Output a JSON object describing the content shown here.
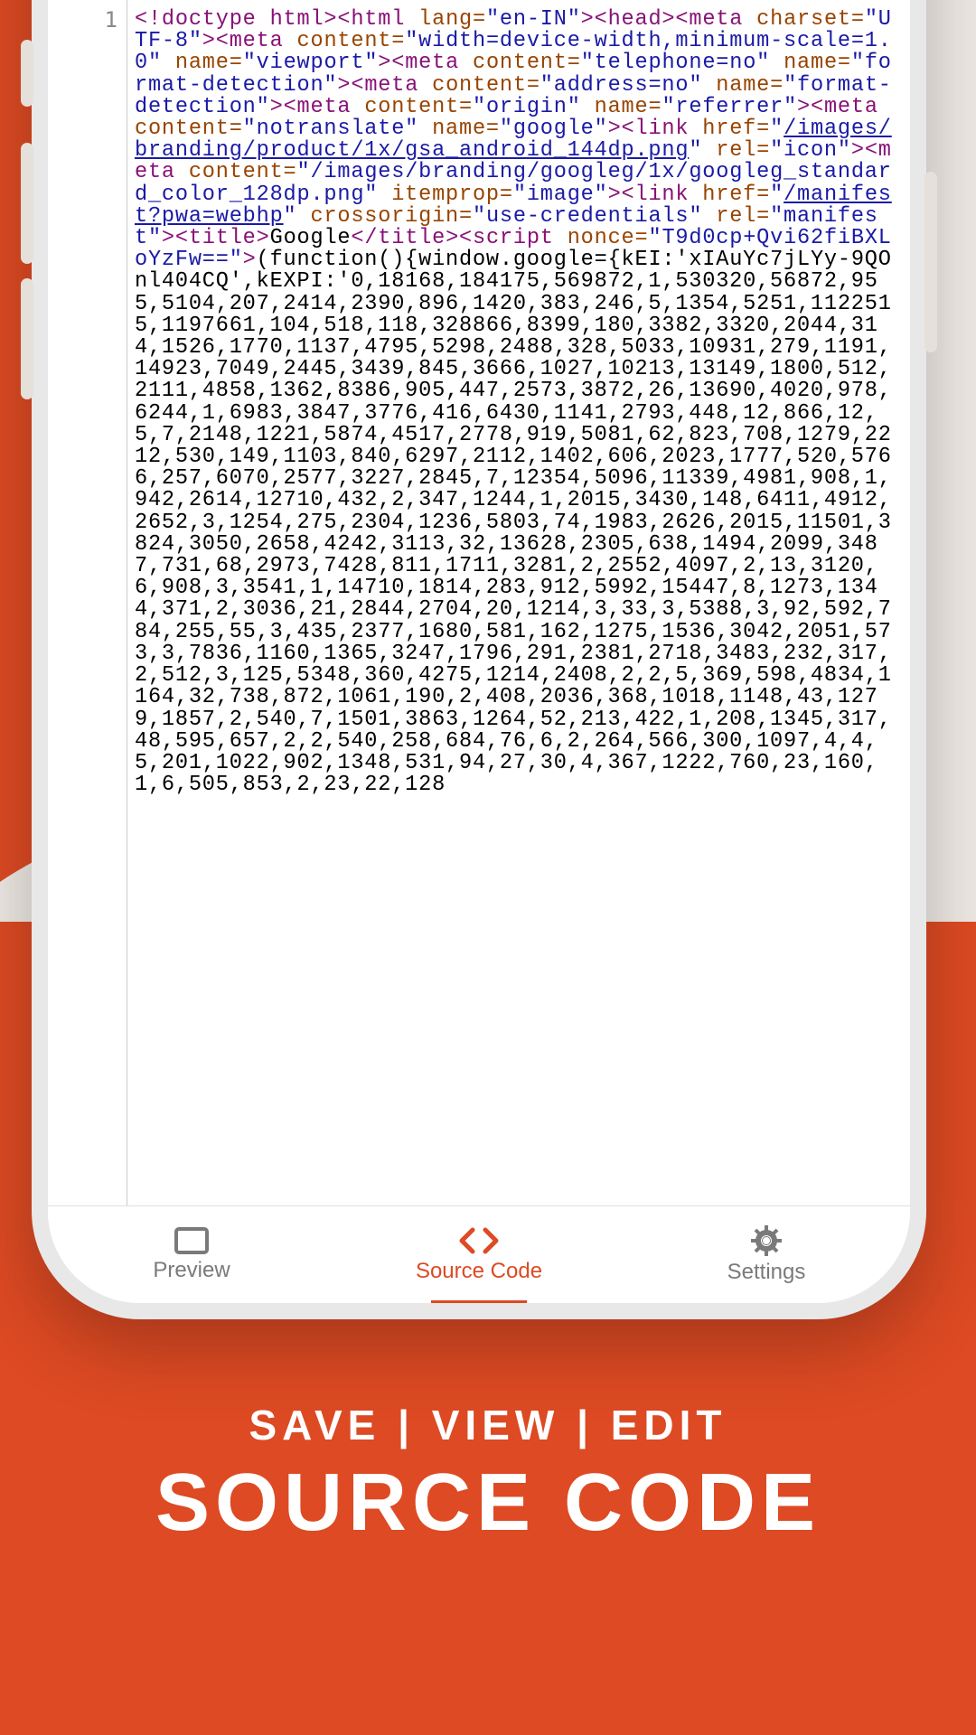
{
  "gutter": {
    "line1": "1"
  },
  "code": {
    "frag_doctype": "<!doctype html>",
    "frag_html_open": "<html",
    "frag_lang_attr": " lang=",
    "frag_lang_val": "\"en-IN\"",
    "gt": ">",
    "frag_head": "<head>",
    "frag_meta": "<meta",
    "frag_charset_attr": " charset=",
    "frag_charset_val": "\"UTF-8\"",
    "frag_content_attr": " content=",
    "frag_viewport_val": "\"width=device-width,minimum-scale=1.0\"",
    "frag_name_attr": " name=",
    "frag_viewport_name": "\"viewport\"",
    "frag_tel_val": "\"telephone=no\"",
    "frag_fmt_name": "\"format-detection\"",
    "frag_addr_val": "\"address=no\"",
    "frag_origin_val": "\"origin\"",
    "frag_ref_name": "\"referrer\"",
    "frag_notr_val": "\"notranslate\"",
    "frag_google_name": "\"google\"",
    "frag_link": "<link",
    "frag_href_attr": " href=",
    "frag_icon_url": "/images/branding/product/1x/gsa_android_144dp.png",
    "frag_q": "\"",
    "frag_rel_attr": " rel=",
    "frag_icon_rel": "\"icon\"",
    "frag_gimg_val": "\"/images/branding/googleg/1x/googleg_standard_color_128dp.png\"",
    "frag_itemprop_attr": " itemprop=",
    "frag_image_val": "\"image\"",
    "frag_manifest_url": "/manifest?pwa=webhp",
    "frag_cross_attr": " crossorigin=",
    "frag_cross_val": "\"use-credentials\"",
    "frag_manifest_rel": "\"manifest\"",
    "frag_title_open": "<title>",
    "frag_title_txt": "Google",
    "frag_title_close": "</title>",
    "frag_script": "<script",
    "frag_nonce_attr": " nonce=",
    "frag_nonce_val": "\"T9d0cp+Qvi62fiBXLoYzFw==\"",
    "frag_js": "(function(){window.google={kEI:'xIAuYc7jLYy-9QOnl404CQ',kEXPI:'0,18168,184175,569872,1,530320,56872,955,5104,207,2414,2390,896,1420,383,246,5,1354,5251,1122515,1197661,104,518,118,328866,8399,180,3382,3320,2044,314,1526,1770,1137,4795,5298,2488,328,5033,10931,279,1191,14923,7049,2445,3439,845,3666,1027,10213,13149,1800,512,2111,4858,1362,8386,905,447,2573,3872,26,13690,4020,978,6244,1,6983,3847,3776,416,6430,1141,2793,448,12,866,12,5,7,2148,1221,5874,4517,2778,919,5081,62,823,708,1279,2212,530,149,1103,840,6297,2112,1402,606,2023,1777,520,5766,257,6070,2577,3227,2845,7,12354,5096,11339,4981,908,1,942,2614,12710,432,2,347,1244,1,2015,3430,148,6411,4912,2652,3,1254,275,2304,1236,5803,74,1983,2626,2015,11501,3824,3050,2658,4242,3113,32,13628,2305,638,1494,2099,3487,731,68,2973,7428,811,1711,3281,2,2552,4097,2,13,3120,6,908,3,3541,1,14710,1814,283,912,5992,15447,8,1273,1344,371,2,3036,21,2844,2704,20,1214,3,33,3,5388,3,92,592,784,255,55,3,435,2377,1680,581,162,1275,1536,3042,2051,573,3,7836,1160,1365,3247,1796,291,2381,2718,3483,232,317,2,512,3,125,5348,360,4275,1214,2408,2,2,5,369,598,4834,1164,32,738,872,1061,190,2,408,2036,368,1018,1148,43,1279,1857,2,540,7,1501,3863,1264,52,213,422,1,208,1345,317,48,595,657,2,2,540,258,684,76,6,2,264,566,300,1097,4,4,5,201,1022,902,1348,531,94,27,30,4,367,1222,760,23,160,1,6,505,853,2,23,22,128"
  },
  "nav": {
    "preview": "Preview",
    "source": "Source Code",
    "settings": "Settings"
  },
  "tagline": {
    "small": "SAVE | VIEW | EDIT",
    "big": "SOURCE CODE"
  }
}
